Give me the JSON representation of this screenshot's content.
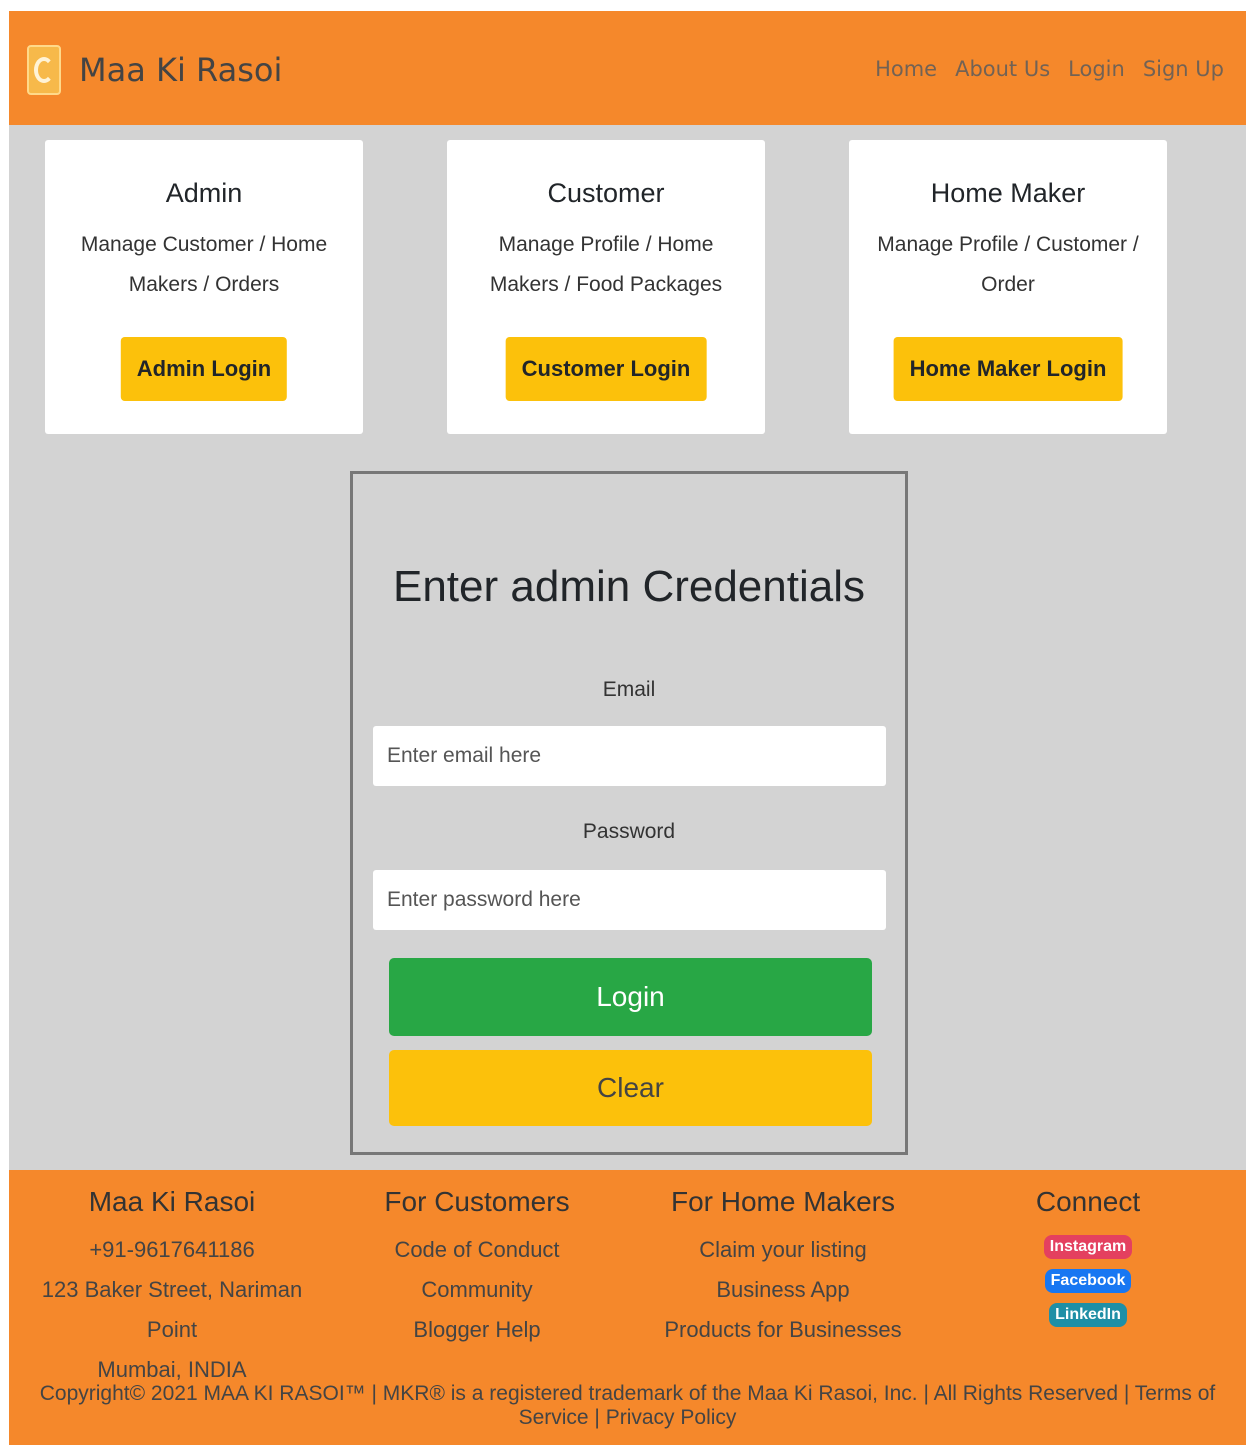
{
  "navbar": {
    "brand": "Maa Ki Rasoi",
    "links": [
      "Home",
      "About Us",
      "Login",
      "Sign Up"
    ]
  },
  "cards": [
    {
      "title": "Admin",
      "description": "Manage Customer / Home Makers / Orders",
      "button": "Admin Login"
    },
    {
      "title": "Customer",
      "description": "Manage Profile / Home Makers / Food Packages",
      "button": "Customer Login"
    },
    {
      "title": "Home Maker",
      "description": "Manage Profile / Customer / Order",
      "button": "Home Maker Login"
    }
  ],
  "login_form": {
    "heading": "Enter admin Credentials",
    "email_label": "Email",
    "email_placeholder": "Enter email here",
    "password_label": "Password",
    "password_placeholder": "Enter password here",
    "login_button": "Login",
    "clear_button": "Clear"
  },
  "footer": {
    "col1": {
      "title": "Maa Ki Rasoi",
      "lines": [
        "+91-9617641186",
        "123 Baker Street, Nariman Point",
        "Mumbai, INDIA"
      ]
    },
    "col2": {
      "title": "For Customers",
      "links": [
        "Code of Conduct",
        "Community",
        "Blogger Help"
      ]
    },
    "col3": {
      "title": "For Home Makers",
      "links": [
        "Claim your listing",
        "Business App",
        "Products for Businesses"
      ]
    },
    "col4": {
      "title": "Connect",
      "social": [
        "Instagram",
        "Facebook",
        "LinkedIn"
      ]
    },
    "copyright": "Copyright© 2021 MAA KI RASOI™ | MKR® is a registered trademark of the Maa Ki Rasoi, Inc. | All Rights Reserved | Terms of Service | Privacy Policy"
  },
  "colors": {
    "header_footer": "#f5882b",
    "page_bg": "#d3d3d3",
    "warning": "#fcc10b",
    "success": "#28a745"
  }
}
